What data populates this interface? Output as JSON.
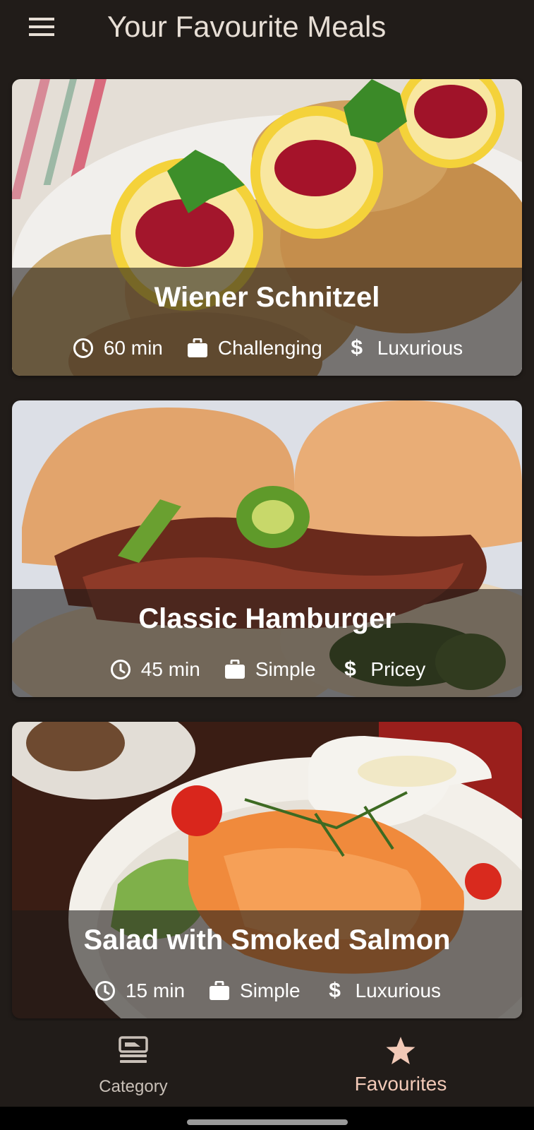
{
  "appbar": {
    "menu_icon": "hamburger-menu-icon",
    "title": "Your Favourite Meals"
  },
  "meals": [
    {
      "title": "Wiener Schnitzel",
      "duration": "60 min",
      "complexity": "Challenging",
      "affordability": "Luxurious",
      "image_icon": "wiener-schnitzel-photo"
    },
    {
      "title": "Classic Hamburger",
      "duration": "45 min",
      "complexity": "Simple",
      "affordability": "Pricey",
      "image_icon": "classic-hamburger-photo"
    },
    {
      "title": "Salad with Smoked Salmon",
      "duration": "15 min",
      "complexity": "Simple",
      "affordability": "Luxurious",
      "image_icon": "smoked-salmon-salad-photo"
    }
  ],
  "meta_icons": {
    "duration": "clock-icon",
    "complexity": "briefcase-icon",
    "affordability": "dollar-icon"
  },
  "bottom_nav": {
    "items": [
      {
        "label": "Category",
        "icon": "category-icon",
        "selected": false
      },
      {
        "label": "Favourites",
        "icon": "star-icon",
        "selected": true
      }
    ]
  },
  "colors": {
    "background": "#211c19",
    "title_text": "#e7ded5",
    "nav_selected": "#f2c9b7",
    "nav_unselected": "#c9c0b8"
  }
}
